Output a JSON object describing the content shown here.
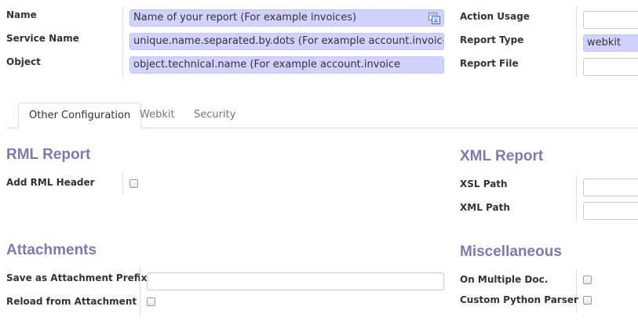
{
  "header_form": {
    "left": [
      {
        "label": "Name",
        "value": "Name of your report (For example invoices)"
      },
      {
        "label": "Service Name",
        "value": "unique.name.separated.by.dots (For example account.invoice.max)"
      },
      {
        "label": "Object",
        "value": "object.technical.name (For example account.invoice"
      }
    ],
    "right": [
      {
        "label": "Action Usage",
        "value": ""
      },
      {
        "label": "Report Type",
        "value": "webkit"
      },
      {
        "label": "Report File",
        "value": ""
      }
    ]
  },
  "tabs": [
    {
      "label": "Other Configuration",
      "active": true
    },
    {
      "label": "Webkit",
      "active": false
    },
    {
      "label": "Security",
      "active": false
    }
  ],
  "rml_report": {
    "title": "RML Report",
    "add_header_label": "Add RML Header",
    "add_header_checked": false
  },
  "xml_report": {
    "title": "XML Report",
    "xsl_path_label": "XSL Path",
    "xsl_path_value": "",
    "xml_path_label": "XML Path",
    "xml_path_value": ""
  },
  "attachments": {
    "title": "Attachments",
    "prefix_label": "Save as Attachment Prefix",
    "prefix_value": "",
    "reload_label": "Reload from Attachment",
    "reload_checked": false
  },
  "miscellaneous": {
    "title": "Miscellaneous",
    "multi_doc_label": "On Multiple Doc.",
    "multi_doc_checked": false,
    "parser_label": "Custom Python Parser",
    "parser_checked": false
  },
  "icons": {
    "translate": "translate-icon"
  },
  "colors": {
    "required_bg": "#d2d2ff",
    "section_title": "#7c7bad"
  }
}
